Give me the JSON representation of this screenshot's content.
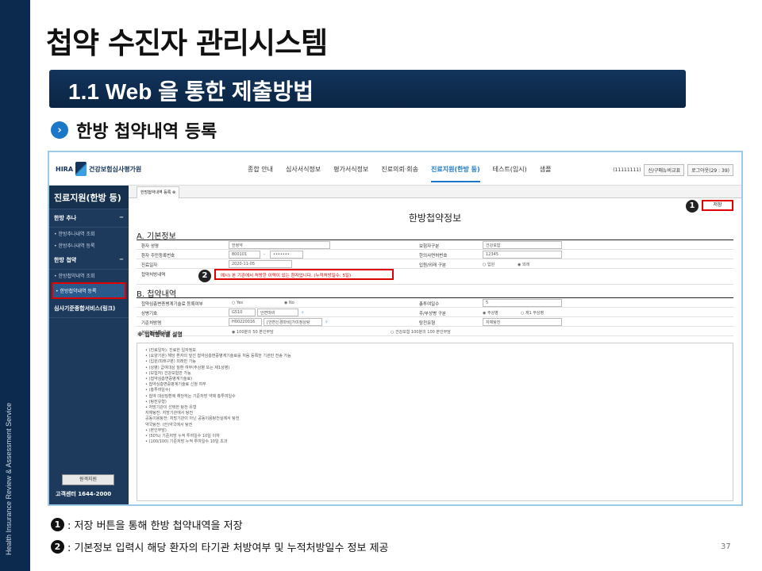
{
  "slide": {
    "title": "첩약 수진자 관리시스템",
    "section": "1.1 Web 을 통한 제출방법",
    "subtitle": "한방 첩약내역 등록",
    "side_text": "Health Insurance Review & Assessment Service",
    "page": "37",
    "notes": [
      {
        "num": "1",
        "text": ": 저장 버튼을 통해 한방 첩약내역을 저장"
      },
      {
        "num": "2",
        "text": ": 기본정보 입력시 해당 환자의 타기관 처방여부 및 누적처방일수 정보 제공"
      }
    ]
  },
  "app": {
    "logo_text": "건강보험심사평가원",
    "logo_prefix": "HIRA",
    "menu": [
      "종합 안내",
      "심사서식정보",
      "평가서식정보",
      "진료의뢰·회송",
      "진료지원(한방 등)",
      "테스트(임시)",
      "샘플"
    ],
    "user": "(11111111)",
    "user_btn1": "신/구매뉴비교표",
    "user_btn2": "로그아웃(29 : 39)",
    "sidebar": {
      "title": "진료지원(한방 등)",
      "g1": "한방 추나",
      "g1_items": [
        "한방추나내역 조회",
        "한방추나내역 등록"
      ],
      "g2": "한방 첩약",
      "g2_items": [
        "한방첩약내역 조회",
        "한방첩약내역 등록"
      ],
      "g3": "심사기준종합서비스(링크)",
      "remote": "원격지원",
      "cs": "고객센터 1644-2000",
      "toggle": "−"
    },
    "tab": "한방첩약내역 등록",
    "page_title": "한방첩약정보",
    "save": "저장",
    "sec_a": "A. 기본정보",
    "sec_b": "B. 첩약내역",
    "basic": {
      "l1": "환자 성명",
      "v1": "한정약",
      "l1b": "보험자구분",
      "v1b": "건강보험",
      "l2": "환자 주민등록번호",
      "v2a": "800101",
      "v2dash": "-",
      "v2b": "•••••••",
      "l2b": "한의사면허번호",
      "v2c": "12345",
      "l3": "진료일자",
      "v3": "2020-11-05",
      "l3b": "입원/외래 구분",
      "r3a": "입원",
      "r3b": "외래",
      "l4": "첩약처방내역",
      "warn": "예시) 본 기관에서 처방한 이력이 있는 환자입니다. (누적처방일수: 5일)"
    },
    "detail": {
      "l1": "첩약심층변증병계기술료 등록여부",
      "r1a": "Yes",
      "r1b": "No",
      "l1b": "총투여일수",
      "v1b": "5",
      "l2": "상병기호",
      "v2a": "G510",
      "v2b": "안면마비",
      "l2b": "주/부상병 구분",
      "r2a": "주상병",
      "r2b": "제1 부상병",
      "l3": "기준처방명",
      "v3a": "H00220016",
      "v3b": "[안면신경마비]가미청상탕",
      "l3b": "탕전유형",
      "v3c": "자체탕전",
      "l4": "본인부담률 구분",
      "r4a": "100분의 50 본인부담",
      "r4b": "건강보험 100분의 100 본인부담"
    },
    "desc_title": "※ 입력항목별 설명",
    "desc_lines": [
      "• (진료일자): 진료한 일자정보",
      "• (요양기관) 해당 환자의 앞선 첩약심층변증병계기술료를 처음 등록한 기관만 전송 가능",
      "• (입원/외래구분) 외래만 가능",
      "• (상병) 급여대상 질환 여부(주상병 또는 제1상병)",
      "• (보험자) 건강보험만 가능",
      "• (첩약심층변증병계기술료)",
      "• 첩약심층변증병계기술료 신청 여부",
      "• (총투여일수)",
      "• 첩약 대상질환에 해당하는 기준처방 약제 총투여일수",
      "• (탕전유형)",
      "• 처방기관이 선택한 탕전 유형",
      "    자체탕전: 처방기관에서 탕전",
      "    공동이용탕전: 처방기관이 아닌 공동이용탕전실에서 탕전",
      "    약국탕전: (한)약국에서 탕전",
      "• (본인부담)",
      "• (50%) 기준처방 누적 투여일수 10일 이하",
      "• (100/100) 기준처방 누적 투여일수 10일 초과"
    ]
  }
}
